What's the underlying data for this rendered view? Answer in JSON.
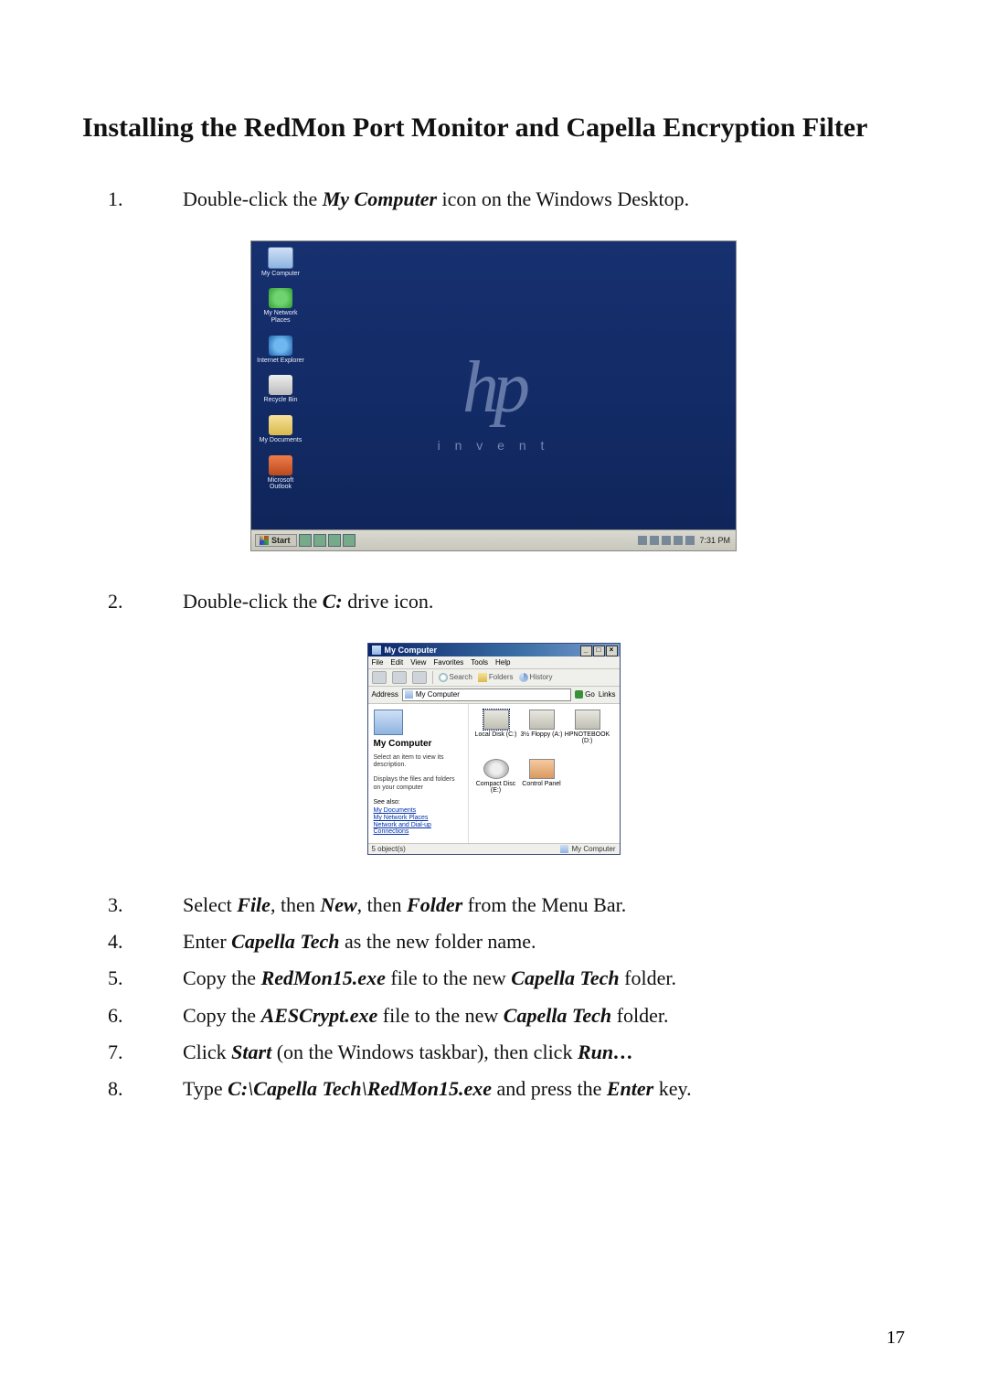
{
  "section_title": "Installing the RedMon Port Monitor and Capella Encryption Filter",
  "page_number": "17",
  "steps": {
    "s1": {
      "num": "1.",
      "pre": "Double-click the ",
      "bold1": "My Computer",
      "post": " icon on the Windows Desktop."
    },
    "s2": {
      "num": "2.",
      "pre": "Double-click the ",
      "bold1": "C:",
      "post": " drive icon."
    },
    "s3": {
      "num": "3.",
      "pre": "Select ",
      "bold1": "File",
      "mid1": ", then ",
      "bold2": "New",
      "mid2": ", then ",
      "bold3": "Folder",
      "post": " from the Menu Bar."
    },
    "s4": {
      "num": "4.",
      "pre": "Enter ",
      "bold1": "Capella Tech",
      "post": " as the new folder name."
    },
    "s5": {
      "num": "5.",
      "pre": "Copy the ",
      "bold1": "RedMon15.exe",
      "mid1": " file to the new ",
      "bold2": "Capella Tech",
      "post": " folder."
    },
    "s6": {
      "num": "6.",
      "pre": "Copy the ",
      "bold1": "AESCrypt.exe",
      "mid1": " file to the new ",
      "bold2": "Capella Tech",
      "post": " folder."
    },
    "s7": {
      "num": "7.",
      "pre": "Click ",
      "bold1": "Start",
      "mid1": " (on the Windows taskbar), then click ",
      "bold2": "Run…",
      "post": ""
    },
    "s8": {
      "num": "8.",
      "pre": "Type ",
      "bold1": "C:\\Capella Tech\\RedMon15.exe",
      "mid1": " and press the ",
      "bold2": "Enter",
      "post": " key."
    }
  },
  "desktop": {
    "icons": {
      "i1": "My Computer",
      "i2": "My Network Places",
      "i3": "Internet Explorer",
      "i4": "Recycle Bin",
      "i5": "My Documents",
      "i6": "Microsoft Outlook"
    },
    "logo": "hp",
    "invent": "i n v e n t",
    "taskbar": {
      "start": "Start",
      "clock": "7:31 PM"
    }
  },
  "window": {
    "title": "My Computer",
    "menu": {
      "file": "File",
      "edit": "Edit",
      "view": "View",
      "fav": "Favorites",
      "tools": "Tools",
      "help": "Help"
    },
    "toolbar": {
      "search": "Search",
      "folders": "Folders",
      "history": "History"
    },
    "addr_label": "Address",
    "addr_value": "My Computer",
    "go": "Go",
    "links": "Links",
    "leftpane": {
      "title": "My Computer",
      "desc1": "Select an item to view its description.",
      "desc2": "Displays the files and folders on your computer",
      "see": "See also:",
      "l1": "My Documents",
      "l2": "My Network Places",
      "l3": "Network and Dial-up Connections"
    },
    "drives": {
      "d1": "Local Disk (C:)",
      "d2": "3½ Floppy (A:)",
      "d3": "HPNOTEBOOK (D:)",
      "d4": "Compact Disc (E:)",
      "d5": "Control Panel"
    },
    "statusbar": {
      "left": "5 object(s)",
      "right": "My Computer"
    }
  }
}
